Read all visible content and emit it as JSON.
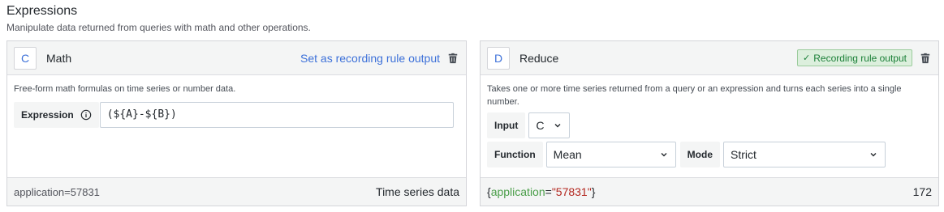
{
  "header": {
    "title": "Expressions",
    "subtitle": "Manipulate data returned from queries with math and other operations."
  },
  "math_card": {
    "ref": "C",
    "type": "Math",
    "set_recording": "Set as recording rule output",
    "description": "Free-form math formulas on time series or number data.",
    "expression_label": "Expression",
    "expression_value": "(${A}-${B})",
    "footer_label": "application=57831",
    "footer_type": "Time series data"
  },
  "reduce_card": {
    "ref": "D",
    "type": "Reduce",
    "recording_badge": "Recording rule output",
    "description": "Takes one or more time series returned from a query or an expression and turns each series into a single number.",
    "input_label": "Input",
    "input_value": "C",
    "function_label": "Function",
    "function_value": "Mean",
    "mode_label": "Mode",
    "mode_value": "Strict",
    "footer_open": "{",
    "footer_key": "application",
    "footer_eq": "=",
    "footer_val": "\"57831\"",
    "footer_close": "}",
    "footer_value": "172"
  },
  "icons": {
    "trash": "trash-icon",
    "info": "info-circle-icon",
    "chevron": "chevron-down-icon",
    "check": "check-icon"
  },
  "colors": {
    "accent": "#3d71d9",
    "success_bg": "#dcefdd",
    "success_text": "#1a7f37",
    "label_key": "#4a9e49",
    "label_value": "#b3261e"
  }
}
